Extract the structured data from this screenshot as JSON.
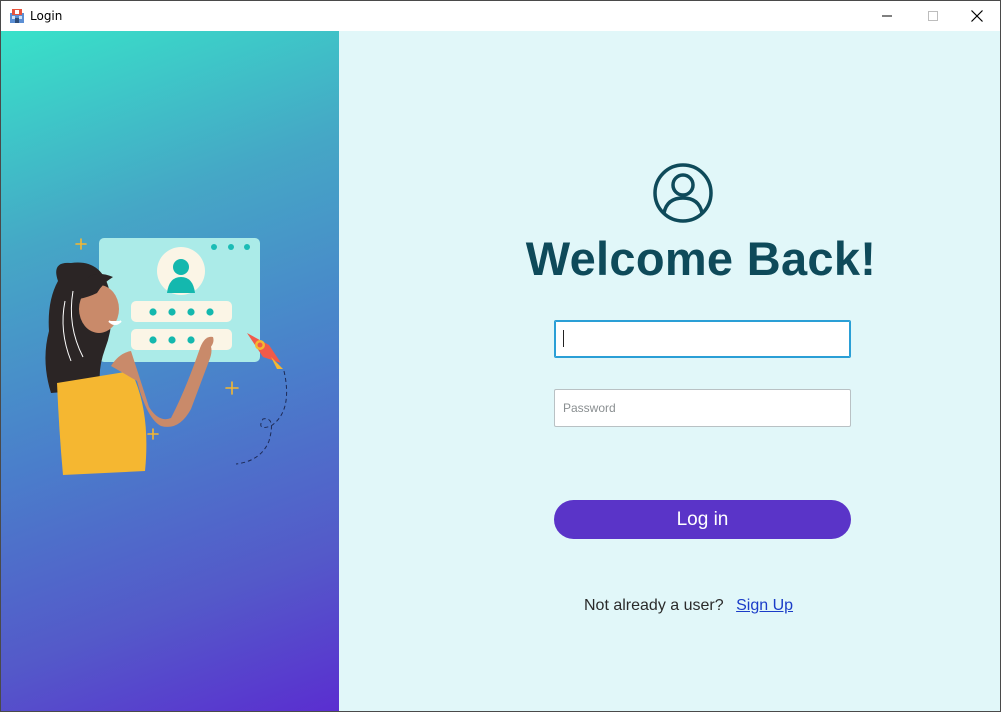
{
  "window": {
    "title": "Login",
    "controls": {
      "minimize_icon": "minimize-icon",
      "maximize_icon": "maximize-icon",
      "close_icon": "close-icon"
    }
  },
  "illustration": {
    "description_icon": "login-illustration",
    "card_color": "#abebe8",
    "figure_shirt_color": "#f5b731"
  },
  "login": {
    "icon": "user-circle-icon",
    "heading": "Welcome Back!",
    "username": {
      "value": "",
      "placeholder": ""
    },
    "password": {
      "value": "",
      "placeholder": "Password"
    },
    "login_button": "Log in",
    "signup_prompt": "Not already a user?",
    "signup_link": "Sign Up"
  },
  "colors": {
    "heading": "#0e4a5a",
    "button": "#5a34c8",
    "right_background": "#e1f7f9",
    "gradient_top": "#38e2c9",
    "gradient_bottom": "#5a2ed0",
    "link": "#1a3cc8"
  }
}
